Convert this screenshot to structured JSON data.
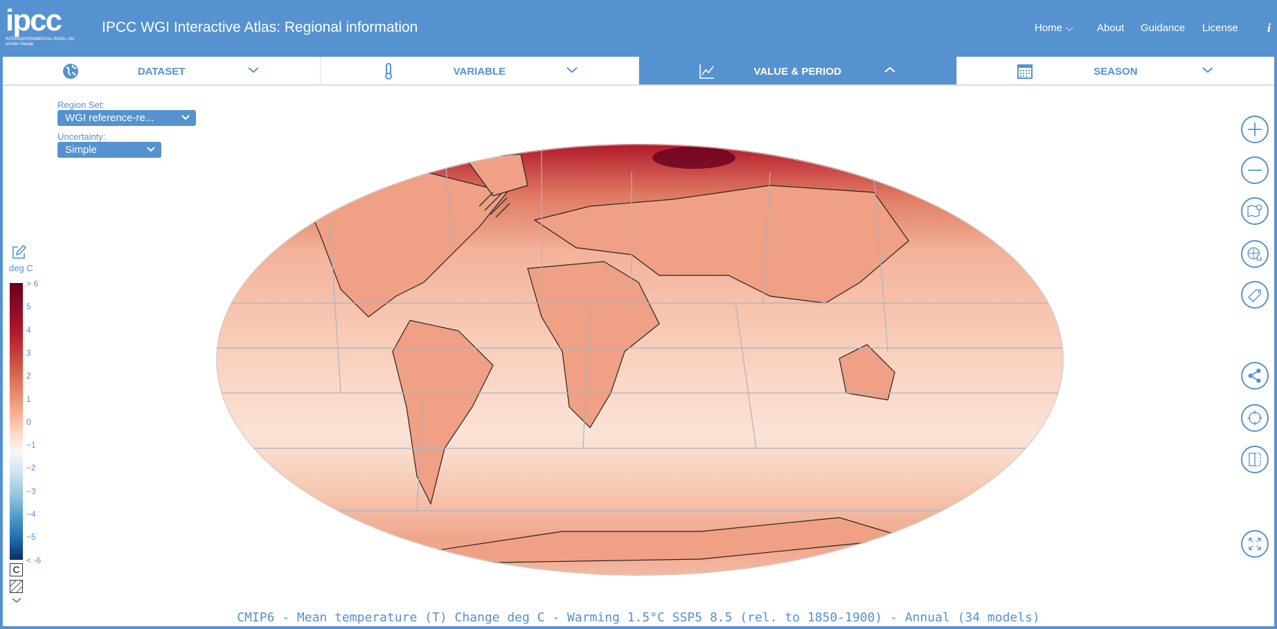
{
  "header": {
    "logo_text": "ipcc",
    "logo_subtext": "INTERGOVERNMENTAL PANEL ON climate change",
    "title": "IPCC WGI Interactive Atlas: Regional information",
    "nav": [
      {
        "label": "Home"
      },
      {
        "label": "About"
      },
      {
        "label": "Guidance"
      },
      {
        "label": "License"
      },
      {
        "label": "i"
      }
    ]
  },
  "tabs": [
    {
      "label": "DATASET",
      "icon": "globe-icon",
      "active": false
    },
    {
      "label": "VARIABLE",
      "icon": "thermometer-icon",
      "active": false
    },
    {
      "label": "VALUE & PERIOD",
      "icon": "line-chart-icon",
      "active": true
    },
    {
      "label": "SEASON",
      "icon": "calendar-icon",
      "active": false
    }
  ],
  "controls": {
    "region_set_label": "Region Set:",
    "region_set_value": "WGI reference-re...",
    "uncertainty_label": "Uncertainty:",
    "uncertainty_value": "Simple"
  },
  "legend": {
    "unit": "deg C",
    "ticks": [
      "> 6",
      "5",
      "4",
      "3",
      "2",
      "1",
      "0",
      "−1",
      "−2",
      "−3",
      "−4",
      "−5",
      "< -6"
    ],
    "coast_toggle": "C",
    "colors": [
      "#67001f",
      "#b2182b",
      "#d6604d",
      "#f4a582",
      "#fddbc7",
      "#f7f7f7",
      "#d1e5f0",
      "#92c5de",
      "#4393c3",
      "#2166ac",
      "#053061"
    ]
  },
  "tools": [
    "zoom-in-icon",
    "zoom-out-icon",
    "map-pin-icon",
    "globe-click-icon",
    "tag-icon",
    "share-icon",
    "crosshair-icon",
    "compare-icon",
    "fullscreen-icon"
  ],
  "caption": "CMIP6 - Mean temperature (T) Change deg C - Warming 1.5°C SSP5 8.5 (rel. to 1850-1900) - Annual (34 models)"
}
